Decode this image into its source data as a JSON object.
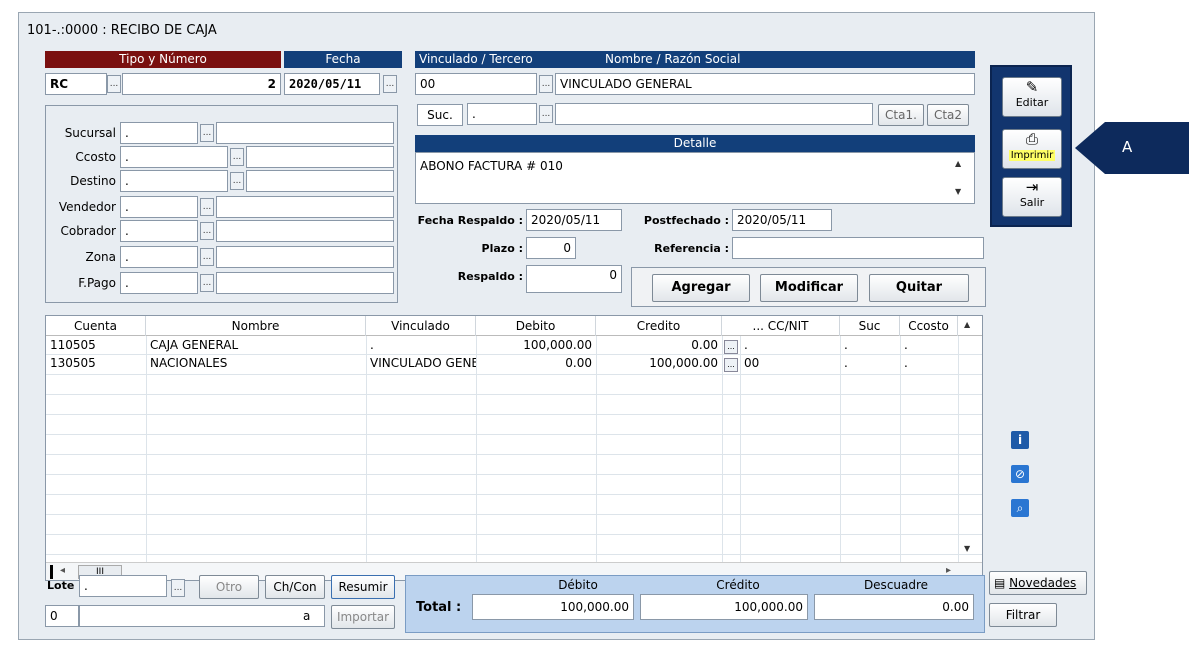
{
  "window": {
    "title": "101-.:0000 : RECIBO DE CAJA"
  },
  "header": {
    "tipo_numero_label": "Tipo y Número",
    "fecha_label": "Fecha",
    "vinculado_label": "Vinculado / Tercero",
    "nombre_label": "Nombre / Razón Social",
    "tipo": "RC",
    "numero": "2",
    "fecha": "2020/05/11",
    "vinculado": "00",
    "nombre": "VINCULADO GENERAL",
    "suc_label": "Suc.",
    "suc_value": ".",
    "cta1": "Cta1.",
    "cta2": "Cta2"
  },
  "left_fields": [
    {
      "label": "Sucursal",
      "value": "."
    },
    {
      "label": "Ccosto",
      "value": "."
    },
    {
      "label": "Destino",
      "value": "."
    },
    {
      "label": "Vendedor",
      "value": "."
    },
    {
      "label": "Cobrador",
      "value": "."
    },
    {
      "label": "Zona",
      "value": "."
    },
    {
      "label": "F.Pago",
      "value": "."
    }
  ],
  "detalle": {
    "label": "Detalle",
    "text": "ABONO FACTURA # 010"
  },
  "extra": {
    "fecha_respaldo_label": "Fecha Respaldo :",
    "fecha_respaldo": "2020/05/11",
    "postfechado_label": "Postfechado :",
    "postfechado": "2020/05/11",
    "plazo_label": "Plazo :",
    "plazo": "0",
    "referencia_label": "Referencia :",
    "referencia": "",
    "respaldo_label": "Respaldo :",
    "respaldo": "0"
  },
  "actions": {
    "agregar": "Agregar",
    "modificar": "Modificar",
    "quitar": "Quitar"
  },
  "grid": {
    "columns": [
      "Cuenta",
      "Nombre",
      "Vinculado",
      "Debito",
      "Credito",
      "... CC/NIT",
      "Suc",
      "Ccosto"
    ],
    "rows": [
      {
        "cuenta": "110505",
        "nombre": "CAJA GENERAL",
        "vinculado": ".",
        "debito": "100,000.00",
        "credito": "0.00",
        "ccnit": ".",
        "suc": ".",
        "ccosto": "."
      },
      {
        "cuenta": "130505",
        "nombre": "NACIONALES",
        "vinculado": "VINCULADO GENE",
        "debito": "0.00",
        "credito": "100,000.00",
        "ccnit": "00",
        "suc": ".",
        "ccosto": "."
      }
    ],
    "hscroll_label": "III"
  },
  "footer": {
    "lote_label": "Lote :",
    "lote_value": ".",
    "otro": "Otro",
    "chcon": "Ch/Con",
    "resumir": "Resumir",
    "num_value": "0",
    "a_label": "a",
    "importar": "Importar"
  },
  "totals": {
    "debito_label": "Débito",
    "credito_label": "Crédito",
    "descuadre_label": "Descuadre",
    "total_label": "Total :",
    "debito": "100,000.00",
    "credito": "100,000.00",
    "descuadre": "0.00"
  },
  "toolbar": {
    "editar": "Editar",
    "imprimir": "Imprimir",
    "salir": "Salir"
  },
  "side": {
    "novedades": "Novedades",
    "filtrar": "Filtrar"
  },
  "callout": {
    "label": "A"
  }
}
